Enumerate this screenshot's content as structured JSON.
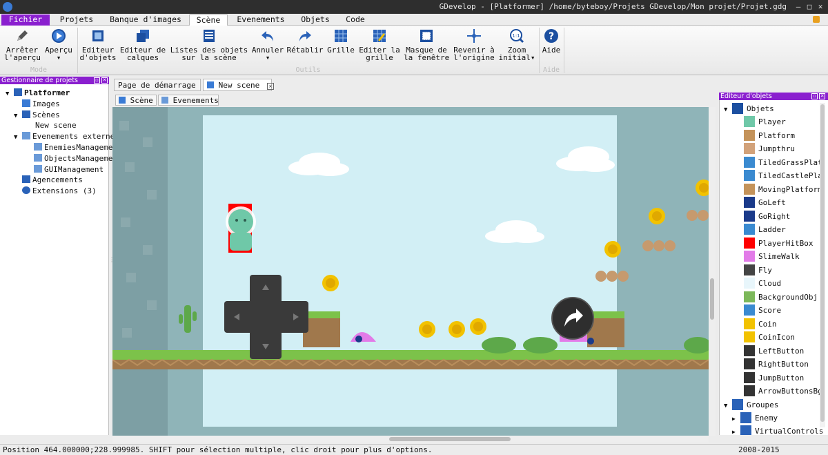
{
  "window": {
    "title": "GDevelop - [Platformer] /home/byteboy/Projets GDevelop/Mon projet/Projet.gdg"
  },
  "menu": {
    "tabs": [
      "Fichier",
      "Projets",
      "Banque d'images",
      "Scène",
      "Evenements",
      "Objets",
      "Code"
    ]
  },
  "ribbon": {
    "stop_preview": [
      "Arrêter",
      "l'aperçu"
    ],
    "preview": "Aperçu",
    "object_editor": [
      "Editeur",
      "d'objets"
    ],
    "layer_editor": [
      "Editeur de",
      "calques"
    ],
    "object_lists": [
      "Listes des objets",
      "sur la scène"
    ],
    "undo": "Annuler",
    "redo": "Rétablir",
    "grid": "Grille",
    "edit_grid": [
      "Editer la",
      "grille"
    ],
    "window_mask": [
      "Masque de",
      "la fenêtre"
    ],
    "back_to_origin": [
      "Revenir à",
      "l'origine"
    ],
    "zoom_initial": [
      "Zoom",
      "initial"
    ],
    "zoom_badge": "1:1",
    "help": "Aide",
    "groups": {
      "mode": "Mode",
      "tools": "Outils",
      "help": "Aide"
    }
  },
  "project_manager": {
    "title": "Gestionnaire de projets",
    "items": [
      {
        "label": "Platformer",
        "level": 0,
        "expanded": true,
        "bold": true
      },
      {
        "label": "Images",
        "level": 1
      },
      {
        "label": "Scènes",
        "level": 1,
        "expanded": true
      },
      {
        "label": "New scene",
        "level": 2
      },
      {
        "label": "Evenements externes",
        "level": 1,
        "expanded": true
      },
      {
        "label": "EnemiesManagement",
        "level": 2
      },
      {
        "label": "ObjectsManagement",
        "level": 2
      },
      {
        "label": "GUIManagement",
        "level": 2
      },
      {
        "label": "Agencements",
        "level": 1
      },
      {
        "label": "Extensions (3)",
        "level": 1
      }
    ]
  },
  "doc_tabs": [
    {
      "label": "Page de démarrage",
      "active": false
    },
    {
      "label": "New scene",
      "active": true
    }
  ],
  "scene_tabs": [
    "Scène",
    "Evenements"
  ],
  "object_editor": {
    "title": "Editeur d'objets",
    "objects_root": "Objets",
    "objects": [
      {
        "name": "Player",
        "color": "#6fc8a8"
      },
      {
        "name": "Platform",
        "color": "#c4935a"
      },
      {
        "name": "Jumpthru",
        "color": "#d2a27a"
      },
      {
        "name": "TiledGrassPlatform",
        "color": "#3a8ad0"
      },
      {
        "name": "TiledCastlePlatform",
        "color": "#3a8ad0"
      },
      {
        "name": "MovingPlatform",
        "color": "#c4935a"
      },
      {
        "name": "GoLeft",
        "color": "#1a3a8a"
      },
      {
        "name": "GoRight",
        "color": "#1a3a8a"
      },
      {
        "name": "Ladder",
        "color": "#3a8ad0"
      },
      {
        "name": "PlayerHitBox",
        "color": "#ff0000"
      },
      {
        "name": "SlimeWalk",
        "color": "#e27be8"
      },
      {
        "name": "Fly",
        "color": "#444444"
      },
      {
        "name": "Cloud",
        "color": "#e8f6fb"
      },
      {
        "name": "BackgroundObj",
        "color": "#7cb85a"
      },
      {
        "name": "Score",
        "color": "#3a8ad0"
      },
      {
        "name": "Coin",
        "color": "#f2c200"
      },
      {
        "name": "CoinIcon",
        "color": "#f2c200"
      },
      {
        "name": "LeftButton",
        "color": "#333333"
      },
      {
        "name": "RightButton",
        "color": "#333333"
      },
      {
        "name": "JumpButton",
        "color": "#333333"
      },
      {
        "name": "ArrowButtonsBg",
        "color": "#333333"
      }
    ],
    "groups_root": "Groupes",
    "groups": [
      "Enemy",
      "VirtualControls"
    ]
  },
  "status": {
    "text": "Position 464.000000;228.999985. SHIFT pour sélection multiple, clic droit pour plus d'options.",
    "copyright": "2008-2015"
  },
  "colors": {
    "accent": "#8a1fcf",
    "sky": "#d2eff5",
    "outside": "#8fb4b8"
  }
}
